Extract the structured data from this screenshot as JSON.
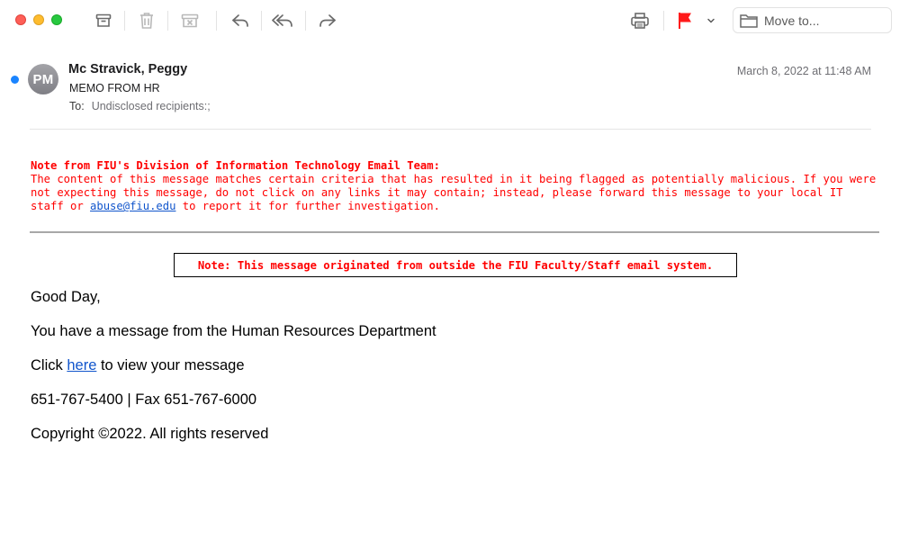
{
  "toolbar": {
    "move_to_label": "Move to...",
    "flag_color": "#ff1a1a"
  },
  "message": {
    "avatar_initials": "PM",
    "sender": "Mc Stravick, Peggy",
    "subject": "MEMO FROM HR",
    "to_label": "To:",
    "to_value": "Undisclosed recipients:;",
    "date": "March 8, 2022 at 11:48 AM"
  },
  "warning": {
    "title": "Note from FIU's Division of Information Technology Email Team:",
    "text_before": "The content of this message matches certain criteria that has resulted in it being flagged as potentially malicious. If you were not expecting this message, do not click on any links it may contain; instead, please forward this message to your local IT staff or ",
    "link": "abuse@fiu.edu",
    "text_after": " to report it for further investigation."
  },
  "notice": "Note: This message originated from outside the FIU Faculty/Staff email system.",
  "body": {
    "greeting": "Good Day,",
    "line1": "You have a message from the Human Resources Department",
    "click_before": "Click ",
    "click_link": "here",
    "click_after": " to view your message",
    "phone": "651-767-5400 | Fax 651-767-6000",
    "copyright": "Copyright ©2022.  All rights reserved"
  }
}
